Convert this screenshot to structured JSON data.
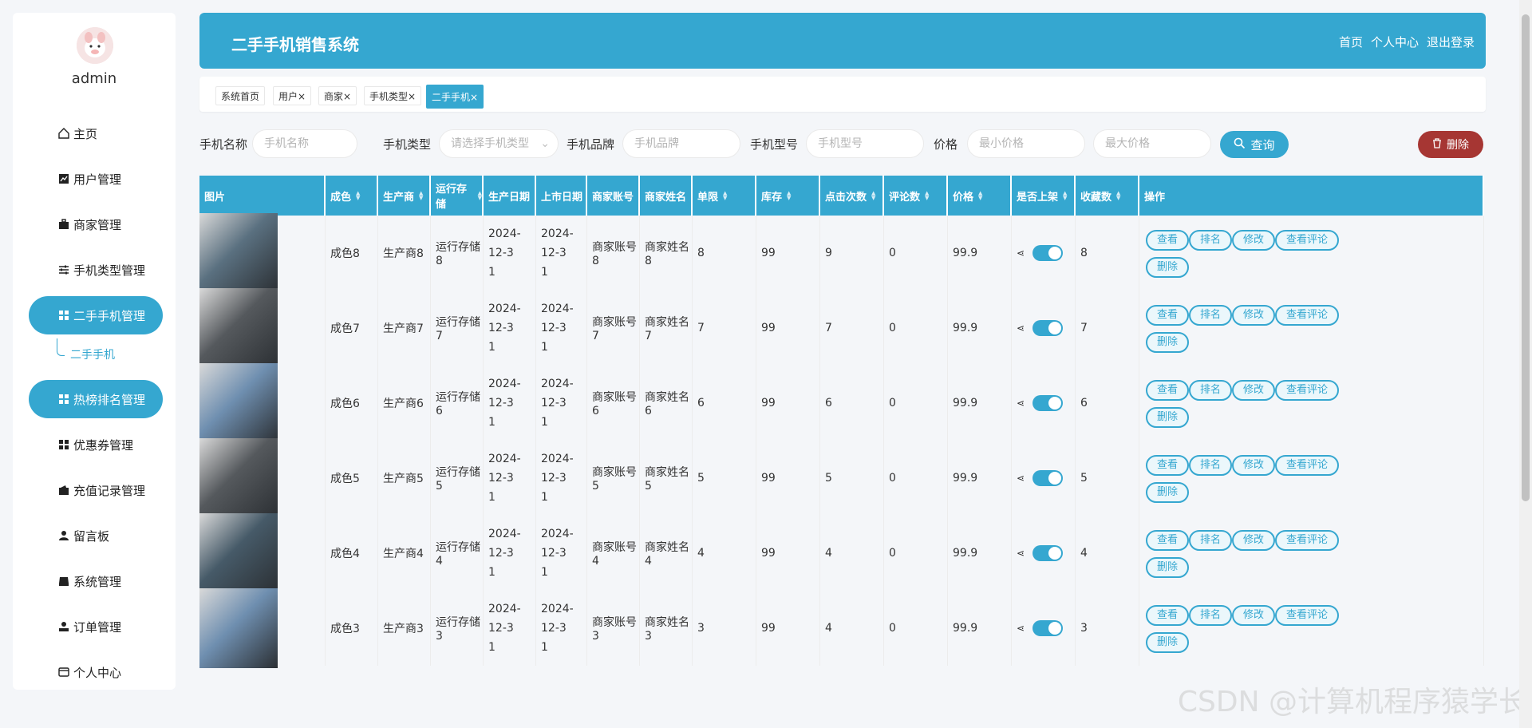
{
  "sidebar": {
    "username": "admin",
    "menu": [
      {
        "label": "主页",
        "icon": "home-icon"
      },
      {
        "label": "用户管理",
        "icon": "chart-icon"
      },
      {
        "label": "商家管理",
        "icon": "briefcase-icon"
      },
      {
        "label": "手机类型管理",
        "icon": "sliders-icon"
      },
      {
        "label": "二手手机管理",
        "icon": "grid-icon"
      },
      {
        "label": "热榜排名管理",
        "icon": "grid-icon"
      },
      {
        "label": "优惠券管理",
        "icon": "grid-icon"
      },
      {
        "label": "充值记录管理",
        "icon": "wallet-icon"
      },
      {
        "label": "留言板",
        "icon": "user-icon"
      },
      {
        "label": "系统管理",
        "icon": "drive-icon"
      },
      {
        "label": "订单管理",
        "icon": "user-tie-icon"
      },
      {
        "label": "个人中心",
        "icon": "card-icon"
      }
    ],
    "submenu_label": "二手手机"
  },
  "header": {
    "title": "二手手机销售系统",
    "links": [
      "首页",
      "个人中心",
      "退出登录"
    ]
  },
  "tabs": [
    {
      "label": "系统首页"
    },
    {
      "label": "用户×"
    },
    {
      "label": "商家×"
    },
    {
      "label": "手机类型×"
    },
    {
      "label": "二手手机×"
    }
  ],
  "filters": {
    "name_label": "手机名称",
    "name_placeholder": "手机名称",
    "type_label": "手机类型",
    "type_placeholder": "请选择手机类型",
    "brand_label": "手机品牌",
    "brand_placeholder": "手机品牌",
    "model_label": "手机型号",
    "model_placeholder": "手机型号",
    "price_label": "价格",
    "min_placeholder": "最小价格",
    "max_placeholder": "最大价格",
    "query_label": "查询",
    "delete_label": "删除"
  },
  "table": {
    "headers": [
      "图片",
      "成色",
      "生产商",
      "运行存储",
      "生产日期",
      "上市日期",
      "商家账号",
      "商家姓名",
      "单限",
      "库存",
      "点击次数",
      "评论数",
      "价格",
      "是否上架",
      "收藏数",
      "操作"
    ],
    "rows": [
      {
        "cond": "成色8",
        "maker": "生产商8",
        "ram": "运行存储8",
        "pdate1": "2024-12-3",
        "pdate2": "1",
        "ldate1": "2024-12-3",
        "ldate2": "1",
        "acct": "商家账号8",
        "mname": "商家姓名8",
        "limit": "8",
        "stock": "99",
        "clicks": "9",
        "comments": "0",
        "price": "99.9",
        "fav": "8",
        "img": "#5a7080"
      },
      {
        "cond": "成色7",
        "maker": "生产商7",
        "ram": "运行存储7",
        "pdate1": "2024-12-3",
        "pdate2": "1",
        "ldate1": "2024-12-3",
        "ldate2": "1",
        "acct": "商家账号7",
        "mname": "商家姓名7",
        "limit": "7",
        "stock": "99",
        "clicks": "7",
        "comments": "0",
        "price": "99.9",
        "fav": "7",
        "img": "#55595d"
      },
      {
        "cond": "成色6",
        "maker": "生产商6",
        "ram": "运行存储6",
        "pdate1": "2024-12-3",
        "pdate2": "1",
        "ldate1": "2024-12-3",
        "ldate2": "1",
        "acct": "商家账号6",
        "mname": "商家姓名6",
        "limit": "6",
        "stock": "99",
        "clicks": "6",
        "comments": "0",
        "price": "99.9",
        "fav": "6",
        "img": "#6f8fb0"
      },
      {
        "cond": "成色5",
        "maker": "生产商5",
        "ram": "运行存储5",
        "pdate1": "2024-12-3",
        "pdate2": "1",
        "ldate1": "2024-12-3",
        "ldate2": "1",
        "acct": "商家账号5",
        "mname": "商家姓名5",
        "limit": "5",
        "stock": "99",
        "clicks": "5",
        "comments": "0",
        "price": "99.9",
        "fav": "5",
        "img": "#55595d"
      },
      {
        "cond": "成色4",
        "maker": "生产商4",
        "ram": "运行存储4",
        "pdate1": "2024-12-3",
        "pdate2": "1",
        "ldate1": "2024-12-3",
        "ldate2": "1",
        "acct": "商家账号4",
        "mname": "商家姓名4",
        "limit": "4",
        "stock": "99",
        "clicks": "4",
        "comments": "0",
        "price": "99.9",
        "fav": "4",
        "img": "#465a68"
      },
      {
        "cond": "成色3",
        "maker": "生产商3",
        "ram": "运行存储3",
        "pdate1": "2024-12-3",
        "pdate2": "1",
        "ldate1": "2024-12-3",
        "ldate2": "1",
        "acct": "商家账号3",
        "mname": "商家姓名3",
        "limit": "3",
        "stock": "99",
        "clicks": "4",
        "comments": "0",
        "price": "99.9",
        "fav": "3",
        "img": "#6f8fb0"
      }
    ],
    "ops": [
      "查看",
      "排名",
      "修改",
      "查看评论",
      "删除"
    ]
  },
  "watermark": "CSDN @计算机程序猿学长"
}
